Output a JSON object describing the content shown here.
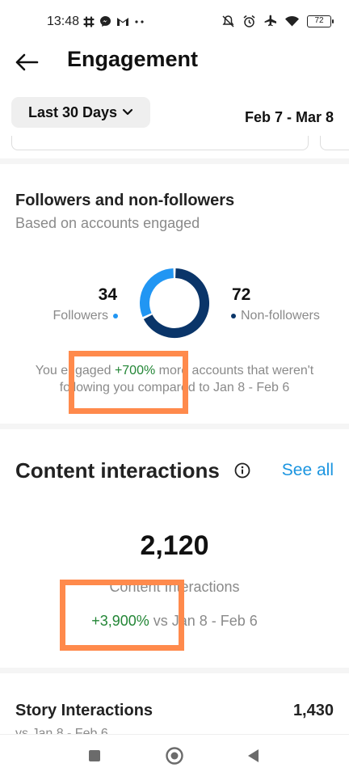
{
  "status_bar": {
    "time": "13:48",
    "left_icons": [
      "slack-icon",
      "messenger-icon",
      "gmail-icon",
      "more-dots-icon"
    ],
    "right_icons": [
      "mute-icon",
      "alarm-icon",
      "airplane-icon",
      "wifi-icon"
    ],
    "battery": "72"
  },
  "header": {
    "title": "Engagement",
    "back_icon": "arrow-left-icon"
  },
  "filter": {
    "range_label": "Last 30 Days",
    "date_range": "Feb 7 - Mar 8"
  },
  "followers_section": {
    "title": "Followers and non-followers",
    "subtitle": "Based on accounts engaged",
    "followers_count": "34",
    "followers_label": "Followers",
    "non_followers_count": "72",
    "non_followers_label": "Non-followers",
    "followers_color": "#2196f3",
    "non_followers_color": "#0a3569",
    "compare_prefix": "You engaged ",
    "compare_percent": "+700%",
    "compare_suffix": " more accounts that weren't following you compared to Jan 8 - Feb 6"
  },
  "content_interactions": {
    "title": "Content interactions",
    "see_all": "See all",
    "value": "2,120",
    "label": "Content Interactions",
    "change": "+3,900%",
    "change_suffix": " vs Jan 8 - Feb 6"
  },
  "story_interactions": {
    "label": "Story Interactions",
    "value": "1,430",
    "sub": "vs Jan 8 - Feb 6"
  },
  "colors": {
    "positive": "#238636",
    "link": "#1b95e0",
    "highlight": "#ff8a4c"
  },
  "nav": [
    "square-icon",
    "home-circle-icon",
    "back-triangle-icon"
  ]
}
